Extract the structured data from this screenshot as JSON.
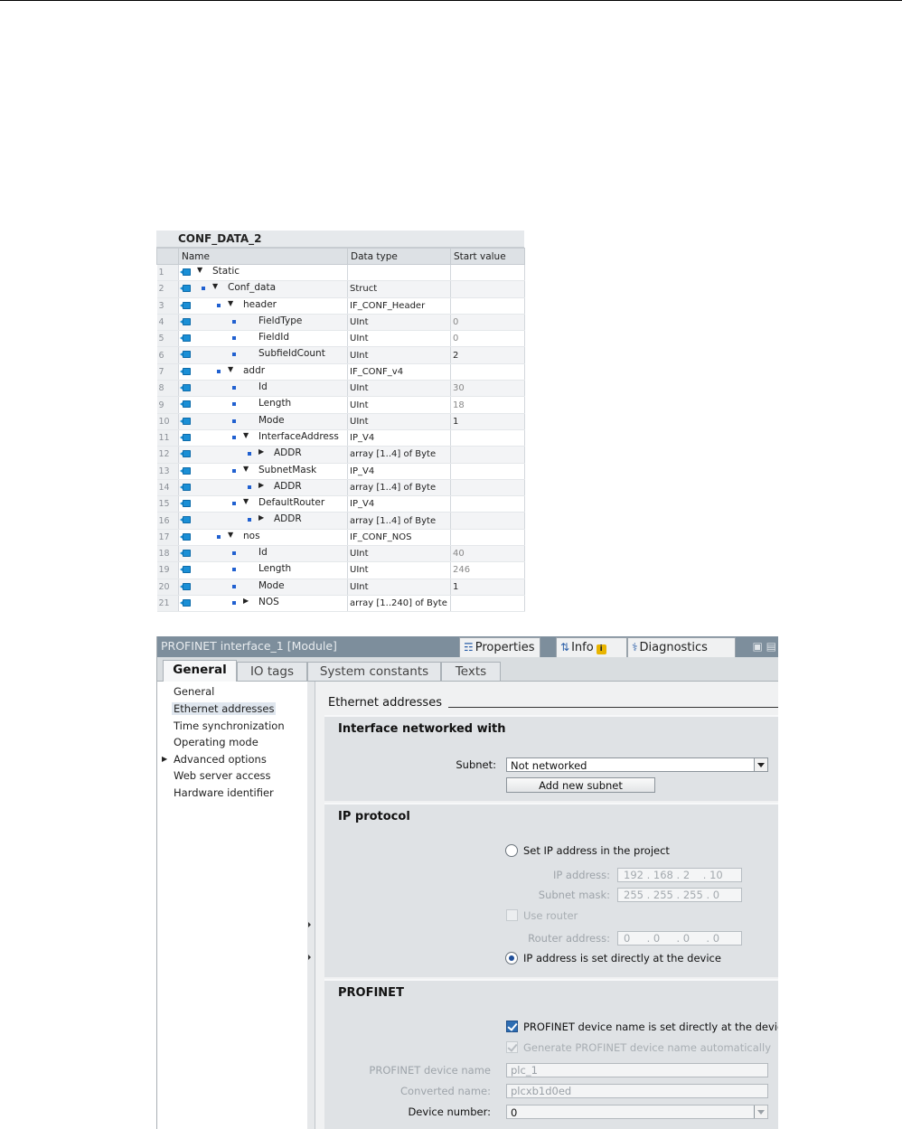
{
  "db": {
    "title": "CONF_DATA_2",
    "headers": [
      "Name",
      "Data type",
      "Start value"
    ],
    "rows": [
      {
        "n": "1",
        "name": "Static",
        "type": "",
        "start": ""
      },
      {
        "n": "2",
        "name": "Conf_data",
        "type": "Struct",
        "start": ""
      },
      {
        "n": "3",
        "name": "header",
        "type": "IF_CONF_Header",
        "start": ""
      },
      {
        "n": "4",
        "name": "FieldType",
        "type": "UInt",
        "start": "0"
      },
      {
        "n": "5",
        "name": "FieldId",
        "type": "UInt",
        "start": "0"
      },
      {
        "n": "6",
        "name": "SubfieldCount",
        "type": "UInt",
        "start": "2"
      },
      {
        "n": "7",
        "name": "addr",
        "type": "IF_CONF_v4",
        "start": ""
      },
      {
        "n": "8",
        "name": "Id",
        "type": "UInt",
        "start": "30"
      },
      {
        "n": "9",
        "name": "Length",
        "type": "UInt",
        "start": "18"
      },
      {
        "n": "10",
        "name": "Mode",
        "type": "UInt",
        "start": "1"
      },
      {
        "n": "11",
        "name": "InterfaceAddress",
        "type": "IP_V4",
        "start": ""
      },
      {
        "n": "12",
        "name": "ADDR",
        "type": "array [1..4] of Byte",
        "start": ""
      },
      {
        "n": "13",
        "name": "SubnetMask",
        "type": "IP_V4",
        "start": ""
      },
      {
        "n": "14",
        "name": "ADDR",
        "type": "array [1..4] of Byte",
        "start": ""
      },
      {
        "n": "15",
        "name": "DefaultRouter",
        "type": "IP_V4",
        "start": ""
      },
      {
        "n": "16",
        "name": "ADDR",
        "type": "array [1..4] of Byte",
        "start": ""
      },
      {
        "n": "17",
        "name": "nos",
        "type": "IF_CONF_NOS",
        "start": ""
      },
      {
        "n": "18",
        "name": "Id",
        "type": "UInt",
        "start": "40"
      },
      {
        "n": "19",
        "name": "Length",
        "type": "UInt",
        "start": "246"
      },
      {
        "n": "20",
        "name": "Mode",
        "type": "UInt",
        "start": "1"
      },
      {
        "n": "21",
        "name": "NOS",
        "type": "array [1..240] of Byte",
        "start": ""
      }
    ]
  },
  "panel": {
    "title": "PROFINET interface_1 [Module]",
    "top_tabs": {
      "properties": "Properties",
      "info": "Info",
      "info_badge": "i",
      "diagnostics": "Diagnostics"
    },
    "tabs": [
      "General",
      "IO tags",
      "System constants",
      "Texts"
    ],
    "nav": [
      "General",
      "Ethernet addresses",
      "Time synchronization",
      "Operating mode",
      "Advanced options",
      "Web server access",
      "Hardware identifier"
    ],
    "heading": "Ethernet addresses",
    "iface": {
      "title": "Interface networked with",
      "subnet_label": "Subnet:",
      "subnet_value": "Not networked",
      "add_subnet": "Add new subnet"
    },
    "ip": {
      "title": "IP protocol",
      "opt_project": "Set IP address in the project",
      "ip_label": "IP address:",
      "ip_value": "192 . 168 . 2    . 10",
      "mask_label": "Subnet mask:",
      "mask_value": "255 . 255 . 255 . 0",
      "use_router": "Use router",
      "router_label": "Router address:",
      "router_value": "0     . 0     . 0     . 0",
      "opt_device": "IP address is set directly at the device"
    },
    "pn": {
      "title": "PROFINET",
      "chk_device_name": "PROFINET device name is set directly at the device",
      "chk_generate": "Generate PROFINET device name automatically",
      "name_label": "PROFINET device name",
      "name_value": "plc_1",
      "conv_label": "Converted name:",
      "conv_value": "plcxb1d0ed",
      "devnum_label": "Device number:",
      "devnum_value": "0"
    }
  }
}
